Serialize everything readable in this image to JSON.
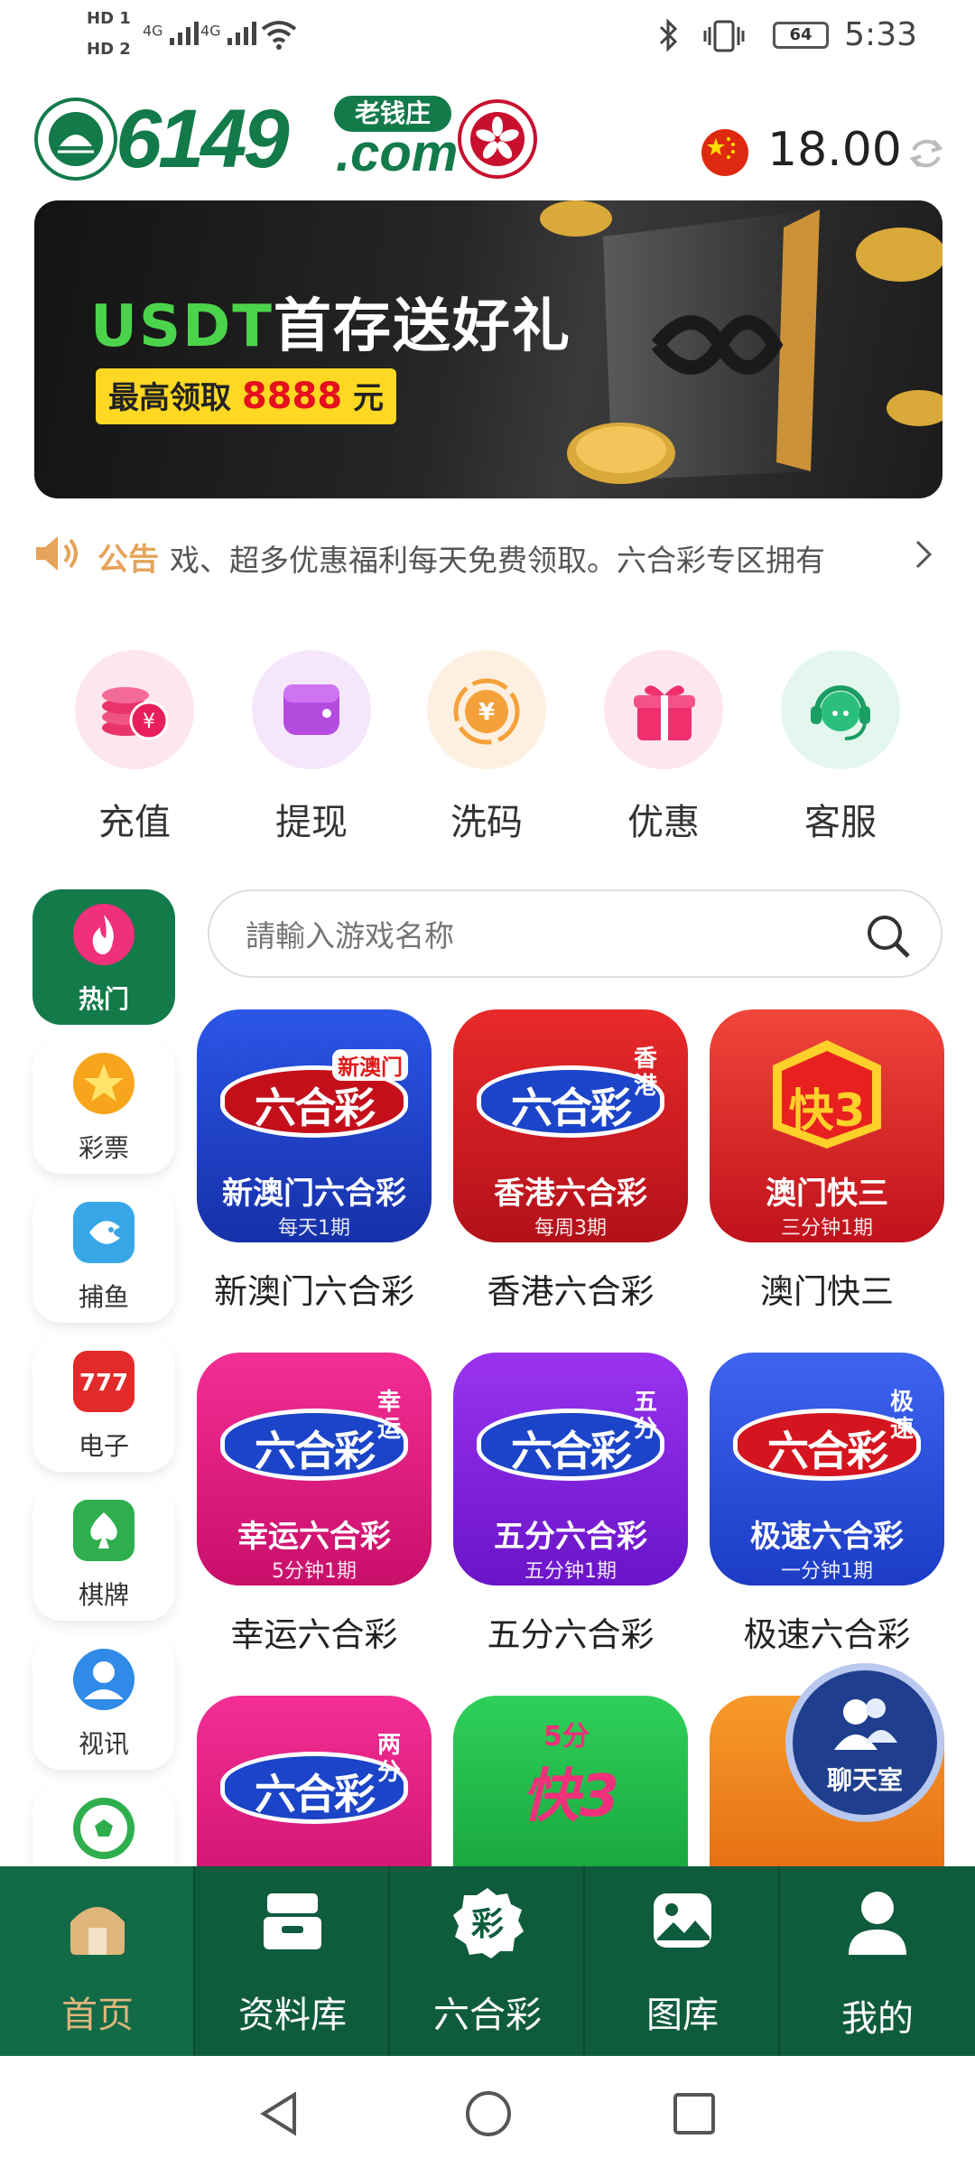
{
  "status_bar": {
    "left_icons": [
      "hd1",
      "hd2",
      "signal-4g",
      "signal-4g",
      "wifi"
    ],
    "hd_labels": [
      "HD 1",
      "HD 2"
    ],
    "net_labels": [
      "4G",
      "4G"
    ],
    "battery": "64",
    "time": "5:33"
  },
  "header": {
    "logo_number": "6149",
    "logo_domain": ".com",
    "logo_tag": "老钱庄",
    "balance": "18.00",
    "flag_icon": "china-flag-icon",
    "refresh_icon": "refresh-icon"
  },
  "banner": {
    "title_highlight": "USDT",
    "title_rest": "首存送好礼",
    "sub_prefix": "最高领取",
    "sub_amount": "8888",
    "sub_suffix": "元"
  },
  "notice": {
    "label": "公告",
    "text": "戏、超多优惠福利每天免费领取。六合彩专区拥有"
  },
  "quick_actions": [
    {
      "label": "充值",
      "icon": "coins-icon",
      "bg": "#fde6ef"
    },
    {
      "label": "提现",
      "icon": "wallet-icon",
      "bg": "#f5e6fb"
    },
    {
      "label": "洗码",
      "icon": "yuan-coin-icon",
      "bg": "#fdf0e1"
    },
    {
      "label": "优惠",
      "icon": "gift-icon",
      "bg": "#fde6ef"
    },
    {
      "label": "客服",
      "icon": "headset-icon",
      "bg": "#e3f7ee"
    }
  ],
  "sidebar": [
    {
      "label": "热门",
      "icon": "flame-icon",
      "active": true
    },
    {
      "label": "彩票",
      "icon": "star-icon"
    },
    {
      "label": "捕鱼",
      "icon": "fish-icon"
    },
    {
      "label": "电子",
      "icon": "slot-777-icon"
    },
    {
      "label": "棋牌",
      "icon": "spade-card-icon"
    },
    {
      "label": "视讯",
      "icon": "live-dealer-icon"
    },
    {
      "label": "",
      "icon": "soccer-ball-icon"
    }
  ],
  "search": {
    "placeholder": "請輸入游戏名称"
  },
  "games": [
    {
      "name": "新澳门六合彩",
      "tile_title": "新澳门六合彩",
      "tile_sub": "每天1期",
      "mark": "六合彩",
      "corner": "新澳门",
      "bg": "#1b3fc4"
    },
    {
      "name": "香港六合彩",
      "tile_title": "香港六合彩",
      "tile_sub": "每周3期",
      "mark": "六合彩",
      "corner": "香港",
      "bg": "#d4151f"
    },
    {
      "name": "澳门快三",
      "tile_title": "澳门快三",
      "tile_sub": "三分钟1期",
      "mark": "快3",
      "corner": "",
      "bg": "#e02020"
    },
    {
      "name": "幸运六合彩",
      "tile_title": "幸运六合彩",
      "tile_sub": "5分钟1期",
      "mark": "六合彩",
      "corner": "幸运",
      "bg": "#e8157e"
    },
    {
      "name": "五分六合彩",
      "tile_title": "五分六合彩",
      "tile_sub": "五分钟1期",
      "mark": "六合彩",
      "corner": "五分",
      "bg": "#7a1fd8"
    },
    {
      "name": "极速六合彩",
      "tile_title": "极速六合彩",
      "tile_sub": "一分钟1期",
      "mark": "六合彩",
      "corner": "极速",
      "bg": "#2f4fe0"
    },
    {
      "name": "",
      "tile_title": "",
      "tile_sub": "",
      "mark": "六合彩",
      "corner": "两分",
      "bg": "#e21a86"
    },
    {
      "name": "",
      "tile_title": "",
      "tile_sub": "",
      "mark": "快3",
      "corner": "5分",
      "bg": "#1daa3a"
    },
    {
      "name": "",
      "tile_title": "",
      "tile_sub": "",
      "mark": "",
      "corner": "",
      "bg": "#ef7a10"
    }
  ],
  "chat_button": {
    "label": "聊天室",
    "icon": "users-icon"
  },
  "bottom_nav": [
    {
      "label": "首页",
      "icon": "home-icon",
      "active": true
    },
    {
      "label": "资料库",
      "icon": "archive-box-icon"
    },
    {
      "label": "六合彩",
      "icon": "lottery-badge-icon",
      "badge": "彩"
    },
    {
      "label": "图库",
      "icon": "image-gallery-icon"
    },
    {
      "label": "我的",
      "icon": "user-profile-icon"
    }
  ],
  "system_nav": [
    "back-icon",
    "home-circle-icon",
    "recents-icon"
  ]
}
